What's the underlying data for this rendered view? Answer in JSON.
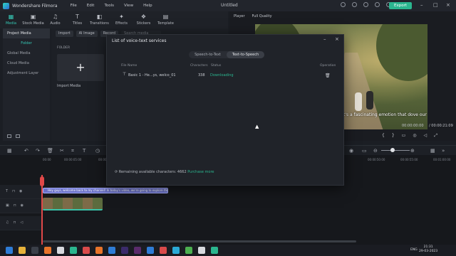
{
  "app": {
    "name": "Wondershare Filmora",
    "menu": [
      "File",
      "Edit",
      "Tools",
      "View",
      "Help"
    ],
    "document_title": "Untitled",
    "export_label": "Export",
    "accent_color": "#2bb68f"
  },
  "tabs": [
    {
      "label": "Media",
      "icon": "media-icon",
      "active": true
    },
    {
      "label": "Stock Media",
      "icon": "stock-media-icon"
    },
    {
      "label": "Audio",
      "icon": "music-note-icon"
    },
    {
      "label": "Titles",
      "icon": "text-t-icon"
    },
    {
      "label": "Transitions",
      "icon": "transitions-icon"
    },
    {
      "label": "Effects",
      "icon": "effects-icon"
    },
    {
      "label": "Stickers",
      "icon": "sticker-icon"
    },
    {
      "label": "Template",
      "icon": "template-icon"
    }
  ],
  "sidebar": {
    "items": [
      {
        "label": "Project Media"
      },
      {
        "label": "Folder"
      },
      {
        "label": "Global Media"
      },
      {
        "label": "Cloud Media"
      },
      {
        "label": "Adjustment Layer"
      }
    ]
  },
  "media": {
    "import_btn": "Import",
    "ai_image_btn": "AI Image",
    "record_btn": "Record",
    "search_placeholder": "Search media",
    "folder_label": "FOLDER",
    "import_tile_label": "Import Media"
  },
  "player": {
    "tab_player": "Player",
    "quality": "Full Quality",
    "caption": "t's a fascinating emotion that dove our",
    "time_current": "00:00:00:00",
    "time_total": "/ 00:00:21:09"
  },
  "dialog": {
    "title": "List of voice-text services",
    "segments": [
      "Speech-to-Text",
      "Text-to-Speech"
    ],
    "active_segment": "Text-to-Speech",
    "columns": {
      "file": "File Name",
      "chars": "Characters",
      "status": "Status",
      "op": "Operation"
    },
    "row": {
      "file": "Basic 1 - He...ys, welco_01",
      "chars": "338",
      "status": "Downloading"
    },
    "footer_prefix": "Remaining available characters: 4662",
    "purchase": "Purchase more"
  },
  "timeline": {
    "ruler": [
      "00:00",
      "00:00:05:00",
      "00:00:10:00",
      "00:00:15:00",
      "00:00:50:00",
      "00:00:55:00",
      "00:01:00:00"
    ],
    "text_clip": "Hey guys, welcome back to my channel! In today's video, we're going to explore the topi..."
  },
  "taskbar": {
    "lang": "ENG",
    "time": "21:31",
    "date": "29-03-2023"
  }
}
